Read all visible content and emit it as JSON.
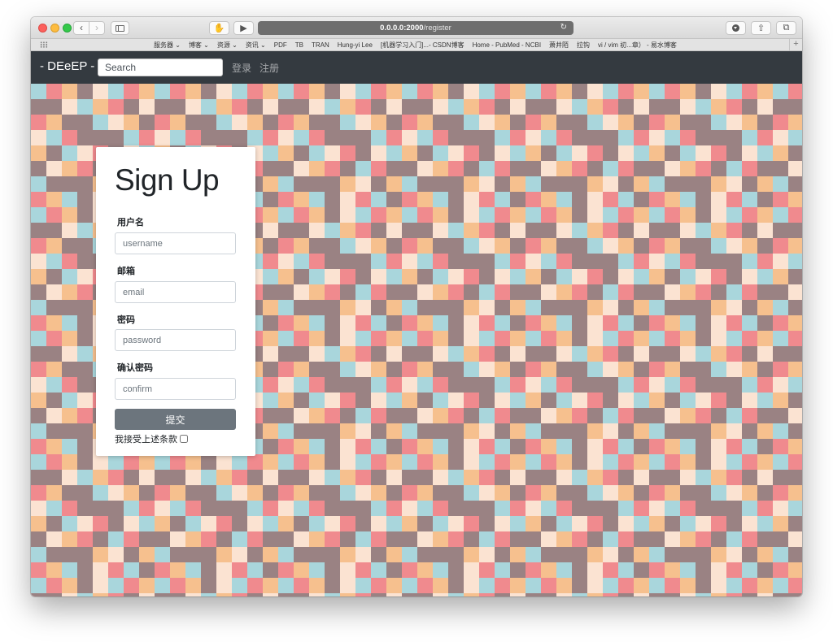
{
  "browser": {
    "url_host": "0.0.0.0:2000",
    "url_path": "/register",
    "bookmarks": [
      "服务器 ⌄",
      "博客 ⌄",
      "资源 ⌄",
      "资讯 ⌄",
      "PDF",
      "TB",
      "TRAN",
      "Hung-yi Lee",
      "[机器学习入门]...- CSDN博客",
      "Home - PubMed - NCBI",
      "萧井陌",
      "拉钩",
      "vi / vim 初...章） - 易水博客"
    ],
    "plus": "+"
  },
  "navbar": {
    "brand": "- DEeEP -",
    "search_placeholder": "Search",
    "login": "登录",
    "register": "注册"
  },
  "form": {
    "title": "Sign Up",
    "username_label": "用户名",
    "username_placeholder": "username",
    "email_label": "邮箱",
    "email_placeholder": "email",
    "password_label": "密码",
    "password_placeholder": "password",
    "confirm_label": "确认密码",
    "confirm_placeholder": "confirm",
    "submit_label": "提交",
    "terms_label": "我接受上述条款",
    "terms_checked": false
  },
  "background": {
    "colors": [
      "#a9d6dc",
      "#f08a8e",
      "#9a8283",
      "#f6c08e",
      "#fbe3d2"
    ]
  }
}
